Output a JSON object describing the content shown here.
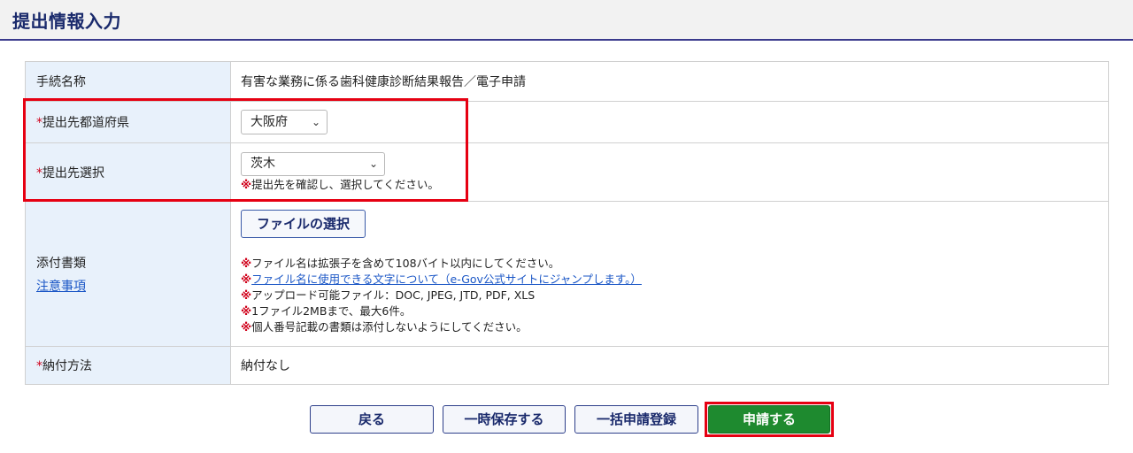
{
  "page_title": "提出情報入力",
  "required_mark": "*",
  "note_mark": "※",
  "rows": {
    "procedure": {
      "label": "手続名称",
      "value": "有害な業務に係る歯科健康診断結果報告／電子申請"
    },
    "prefecture": {
      "label": "提出先都道府県",
      "selected": "大阪府"
    },
    "destination": {
      "label": "提出先選択",
      "selected": "茨木",
      "note": "提出先を確認し、選択してください。"
    },
    "attachment": {
      "label": "添付書類",
      "link": "注意事項",
      "file_button": "ファイルの選択",
      "notes": [
        "ファイル名は拡張子を含めて108バイト以内にしてください。",
        "ファイル名に使用できる文字について（e-Gov公式サイトにジャンプします。）",
        "アップロード可能ファイル：DOC, JPEG, JTD, PDF, XLS",
        "1ファイル2MBまで、最大6件。",
        "個人番号記載の書類は添付しないようにしてください。"
      ]
    },
    "payment": {
      "label": "納付方法",
      "value": "納付なし"
    }
  },
  "buttons": {
    "back": "戻る",
    "temp_save": "一時保存する",
    "bulk_register": "一括申請登録",
    "apply": "申請する"
  },
  "colors": {
    "header_title": "#1a2a6c",
    "label_bg": "#e8f1fb",
    "required": "#d0021b",
    "highlight": "#e60012",
    "apply_button": "#1e8a2f",
    "link": "#1a56c6"
  },
  "icons": {
    "dropdown": "chevron-down-icon"
  }
}
